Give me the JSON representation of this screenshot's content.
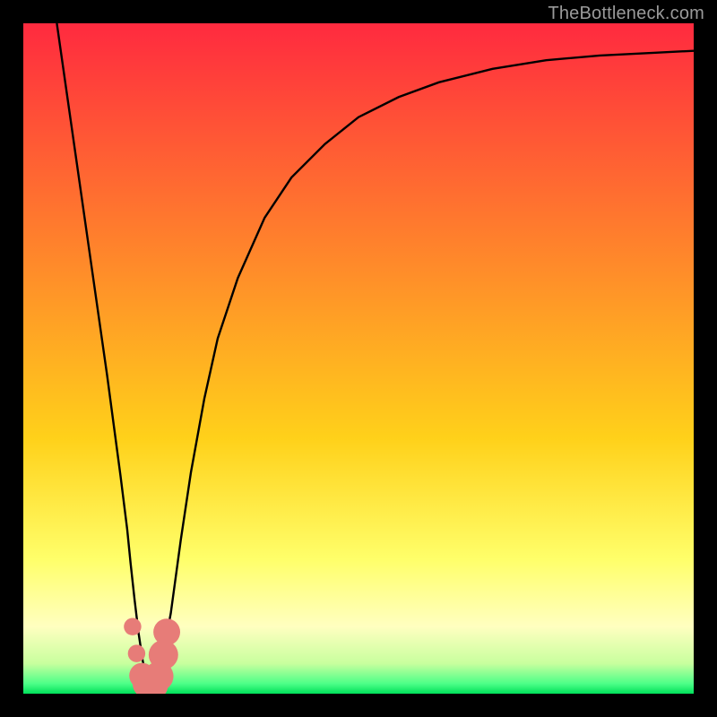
{
  "watermark": "TheBottleneck.com",
  "colors": {
    "black": "#000000",
    "curve": "#000000",
    "marker_fill": "#e77c78",
    "marker_stroke": "#d6605c",
    "gradient_top": "#ff1744",
    "gradient_mid": "#ffd11a",
    "gradient_low": "#ffff8a",
    "gradient_green": "#00e676"
  },
  "chart_data": {
    "type": "line",
    "title": "",
    "xlabel": "",
    "ylabel": "",
    "xlim": [
      0,
      100
    ],
    "ylim": [
      0,
      100
    ],
    "gradient_stops": [
      {
        "offset": 0.0,
        "color": "#ff2a3f"
      },
      {
        "offset": 0.36,
        "color": "#ff8a2a"
      },
      {
        "offset": 0.62,
        "color": "#ffd11a"
      },
      {
        "offset": 0.8,
        "color": "#ffff6a"
      },
      {
        "offset": 0.9,
        "color": "#ffffc0"
      },
      {
        "offset": 0.955,
        "color": "#c8ff9e"
      },
      {
        "offset": 0.985,
        "color": "#4dff88"
      },
      {
        "offset": 1.0,
        "color": "#00e05a"
      }
    ],
    "series": [
      {
        "name": "bottleneck-curve",
        "x": [
          5.0,
          6.5,
          8.0,
          9.5,
          11.0,
          12.5,
          13.5,
          14.5,
          15.5,
          16.0,
          16.6,
          17.2,
          17.8,
          18.3,
          18.7,
          19.3,
          20.5,
          22.0,
          23.5,
          25.0,
          27.0,
          29.0,
          32.0,
          36.0,
          40.0,
          45.0,
          50.0,
          56.0,
          62.0,
          70.0,
          78.0,
          86.0,
          94.0,
          100.0
        ],
        "y": [
          100.0,
          89.5,
          79.0,
          68.5,
          58.0,
          47.5,
          40.0,
          32.5,
          24.5,
          19.5,
          14.0,
          9.0,
          5.0,
          2.5,
          1.0,
          1.3,
          4.0,
          12.0,
          23.0,
          33.0,
          44.0,
          53.0,
          62.0,
          71.0,
          77.0,
          82.0,
          86.0,
          89.0,
          91.2,
          93.2,
          94.5,
          95.2,
          95.6,
          95.9
        ]
      }
    ],
    "markers": [
      {
        "x": 16.3,
        "y": 10.0,
        "r": 1.3
      },
      {
        "x": 16.9,
        "y": 6.0,
        "r": 1.3
      },
      {
        "x": 17.7,
        "y": 2.7,
        "r": 1.9
      },
      {
        "x": 18.5,
        "y": 1.5,
        "r": 2.2
      },
      {
        "x": 19.4,
        "y": 1.3,
        "r": 2.2
      },
      {
        "x": 20.2,
        "y": 2.6,
        "r": 2.2
      },
      {
        "x": 20.9,
        "y": 5.8,
        "r": 2.2
      },
      {
        "x": 21.4,
        "y": 9.2,
        "r": 2.0
      }
    ]
  }
}
